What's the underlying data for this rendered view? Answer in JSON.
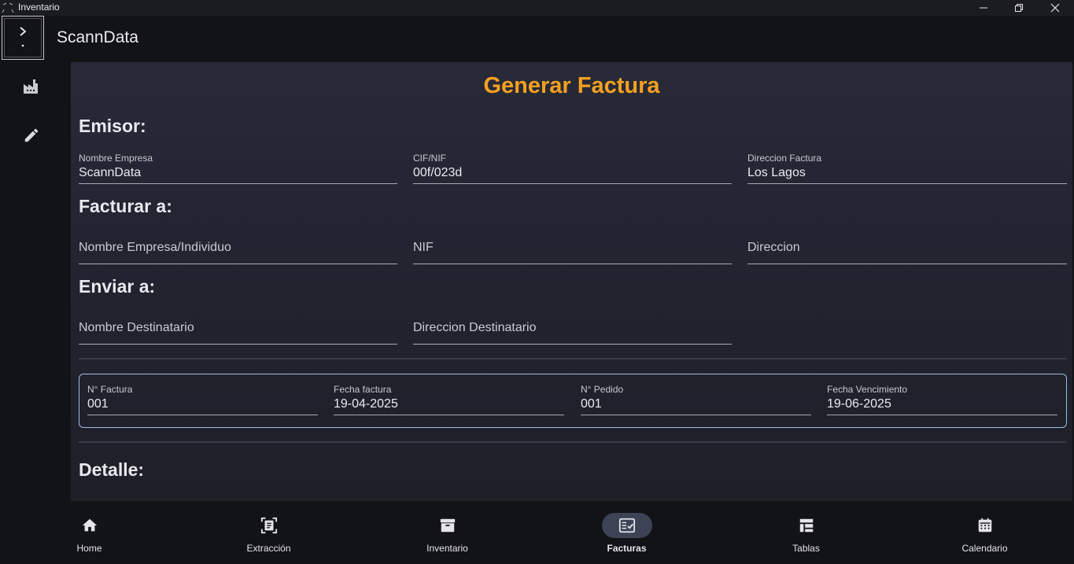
{
  "window": {
    "title": "Inventario",
    "controls": [
      "minimize-icon",
      "maximize-icon",
      "close-icon"
    ]
  },
  "header": {
    "app_title": "ScannData",
    "menu_icons": [
      "chevron-right-icon",
      "dot-icon"
    ]
  },
  "rail": {
    "items": [
      {
        "icon": "factory-icon"
      },
      {
        "icon": "pencil-icon"
      }
    ]
  },
  "main": {
    "title": "Generar Factura",
    "emisor": {
      "heading": "Emisor:",
      "fields": [
        {
          "label": "Nombre Empresa",
          "value": "ScannData"
        },
        {
          "label": "CIF/NIF",
          "value": "00f/023d"
        },
        {
          "label": "Direccion Factura",
          "value": "Los Lagos"
        }
      ]
    },
    "facturar": {
      "heading": "Facturar a:",
      "fields": [
        {
          "placeholder": "Nombre Empresa/Individuo"
        },
        {
          "placeholder": "NIF"
        },
        {
          "placeholder": "Direccion"
        }
      ]
    },
    "enviar": {
      "heading": "Enviar a:",
      "fields": [
        {
          "placeholder": "Nombre Destinatario"
        },
        {
          "placeholder": "Direccion Destinatario"
        }
      ]
    },
    "order": {
      "fields": [
        {
          "label": "N° Factura",
          "value": "001"
        },
        {
          "label": "Fecha factura",
          "value": "19-04-2025"
        },
        {
          "label": "N° Pedido",
          "value": "001"
        },
        {
          "label": "Fecha Vencimiento",
          "value": "19-06-2025"
        }
      ]
    },
    "detalle": {
      "heading": "Detalle:"
    }
  },
  "bottom_nav": {
    "items": [
      {
        "label": "Home",
        "icon": "home-icon",
        "active": false
      },
      {
        "label": "Extracción",
        "icon": "scan-document-icon",
        "active": false
      },
      {
        "label": "Inventario",
        "icon": "archive-box-icon",
        "active": false
      },
      {
        "label": "Facturas",
        "icon": "invoice-check-icon",
        "active": true
      },
      {
        "label": "Tablas",
        "icon": "table-icon",
        "active": false
      },
      {
        "label": "Calendario",
        "icon": "calendar-icon",
        "active": false
      }
    ]
  },
  "colors": {
    "accent": "#f5a020",
    "active_pill": "#3b4354",
    "order_border": "#9cc0e8"
  }
}
